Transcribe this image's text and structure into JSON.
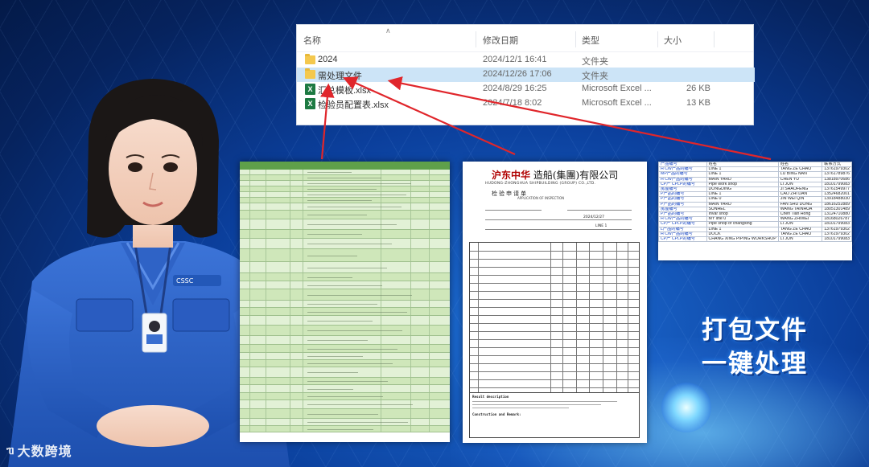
{
  "explorer": {
    "columns": {
      "name": "名称",
      "modified": "修改日期",
      "type": "类型",
      "size": "大小"
    },
    "files": [
      {
        "name": "2024",
        "modified": "2024/12/1 16:41",
        "type": "文件夹",
        "size": "",
        "icon": "folder-icon"
      },
      {
        "name": "需处理文件",
        "modified": "2024/12/26 17:06",
        "type": "文件夹",
        "size": "",
        "icon": "folder-icon"
      },
      {
        "name": "汇总模板.xlsx",
        "modified": "2024/8/29 16:25",
        "type": "Microsoft Excel ...",
        "size": "26 KB",
        "icon": "excel-icon"
      },
      {
        "name": "检验员配置表.xlsx",
        "modified": "2024/7/18 8:02",
        "type": "Microsoft Excel ...",
        "size": "13 KB",
        "icon": "excel-icon"
      }
    ]
  },
  "inspection_doc": {
    "company": "造船(集團)有限公司",
    "brand": "沪东中华",
    "company_en": "HUDONG-ZHONGHUA SHIPBUILDING (GROUP) CO.,LTD.",
    "form_title": "检验申请单",
    "form_title_en": "APPLICATION OF INSPECTION",
    "date_value": "2024/12/27",
    "line_value": "LINE 1",
    "result_heading": "Result description",
    "construction_heading": "Construction and Remark:"
  },
  "contact_sheet": {
    "headers": [
      "产品编号",
      "姓名",
      "姓名",
      "联系方式"
    ],
    "rows": [
      [
        "H CW产品的编号",
        "LINE 1",
        "TANG ZE CHAO",
        "13761979302"
      ],
      [
        "MP产品的编号",
        "LINE 1",
        "LU BING NAN",
        "13761789876"
      ],
      [
        "H CW产品的编号",
        "MAIN YARD",
        "CHEN YU",
        "13818970686"
      ],
      [
        "CP产 CPLP的编号",
        "Pipe work shop",
        "LI JUN",
        "18101799083"
      ],
      [
        "房屋编号",
        "DONGDING",
        "JI SHAOFENG",
        "13761549977"
      ],
      [
        "P产品的编号",
        "LINE 1",
        "CAO ZHI DAN",
        "13524682001"
      ],
      [
        "P产品的编号",
        "LINE 0",
        "JIN WEI QIN",
        "13918488030"
      ],
      [
        "P产品的编号",
        "MAIN YARD",
        "FAN SHU DONG",
        "18616252889"
      ],
      [
        "房屋编号",
        "SUNHEL",
        "WANG TAINHUA",
        "18051301489"
      ],
      [
        "P产品的编号",
        "Invar shop",
        "Chen Tian Hong",
        "13124710880"
      ],
      [
        "H CW产品的编号",
        "MY line 0",
        "WANG ZHIWEI",
        "18168026787"
      ],
      [
        "CP产 CPLP的编号",
        "Pipe shop of changxing",
        "LI JUN",
        "18101799083"
      ],
      [
        "L产品的编号",
        "LINE 1",
        "TANG ZE CHAO",
        "13761979302"
      ],
      [
        "H CW产品的编号",
        "DOCK",
        "TANG ZE CHAO",
        "13761979302"
      ],
      [
        "CP产 CPLP的编号",
        "CHANG XING PIPING WORKSHOP",
        "LI JUN",
        "18101799083"
      ]
    ]
  },
  "caption": {
    "line1": "打包文件",
    "line2": "一键处理"
  },
  "logo": {
    "text": "大数跨境"
  },
  "colors": {
    "accent": "#e0262b",
    "bg": "#0b3f9c",
    "selection": "#cce4f7"
  }
}
